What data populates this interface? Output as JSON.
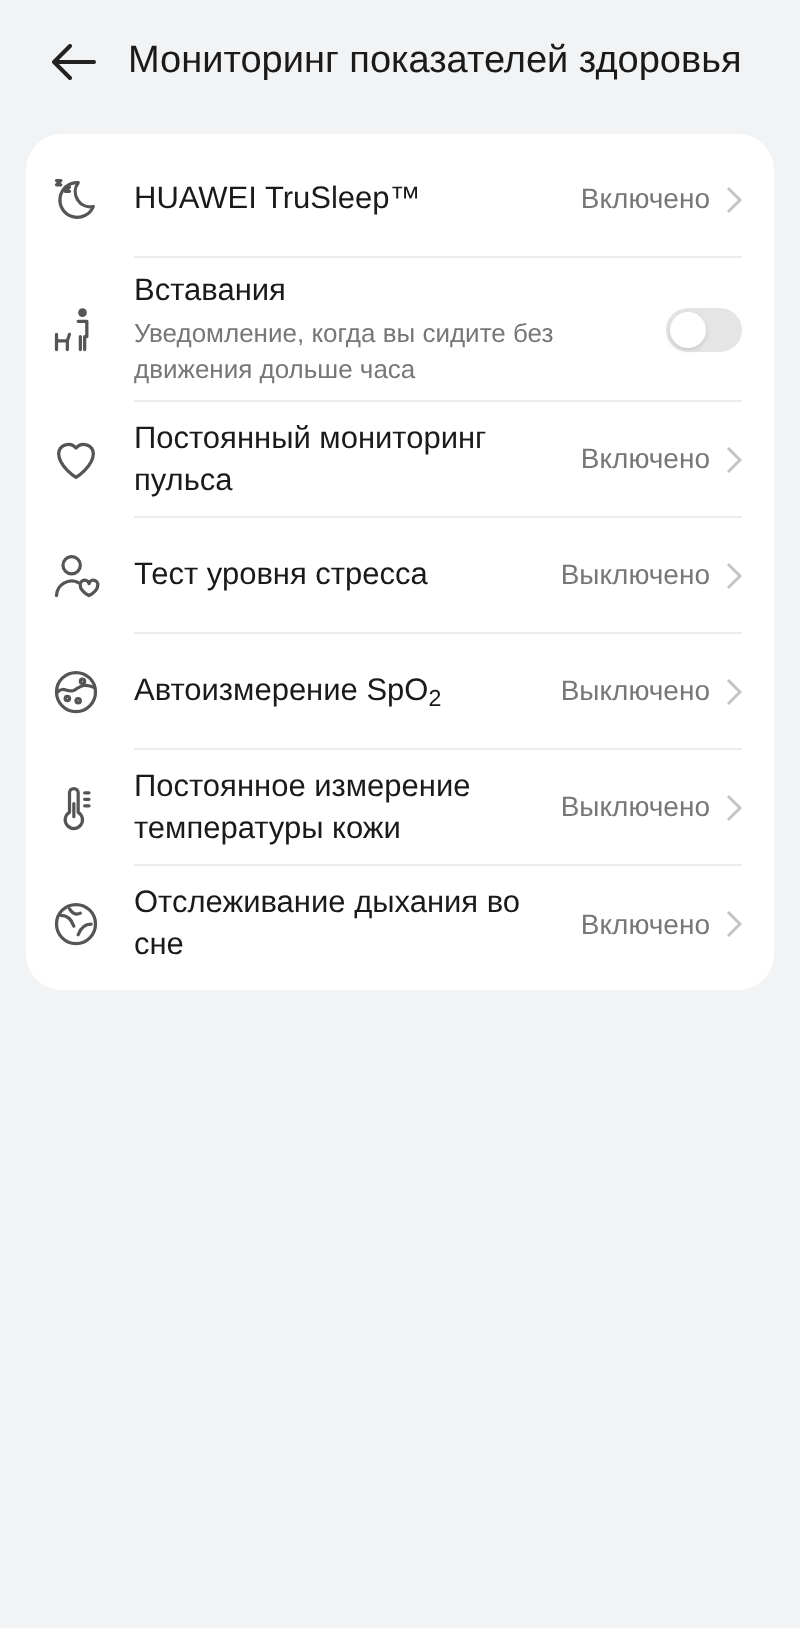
{
  "header": {
    "title": "Мониторинг показателей здоровья"
  },
  "items": [
    {
      "kind": "link",
      "title": "HUAWEI TruSleep™",
      "value": "Включено"
    },
    {
      "kind": "toggle",
      "title": "Вставания",
      "subtitle": "Уведомление, когда вы сидите без движения дольше часа",
      "on": false
    },
    {
      "kind": "link",
      "title": "Постоянный мониторинг пульса",
      "value": "Включено"
    },
    {
      "kind": "link",
      "title": "Тест уровня стресса",
      "value": "Выключено"
    },
    {
      "kind": "link",
      "title": "Автоизмерение SpO$_{2}$",
      "value": "Выключено"
    },
    {
      "kind": "link",
      "title": "Постоянное измерение температуры кожи",
      "value": "Выключено"
    },
    {
      "kind": "link",
      "title": "Отслеживание дыхания во сне",
      "value": "Включено"
    }
  ]
}
